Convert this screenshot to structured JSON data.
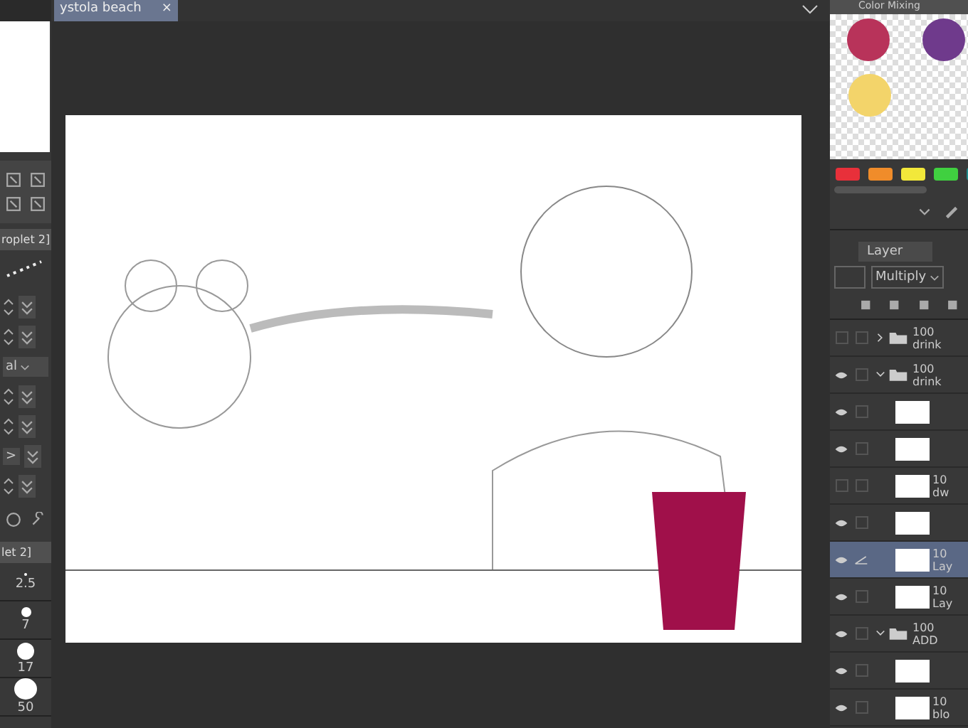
{
  "document_tab": {
    "title": "ystola beach",
    "close": "×"
  },
  "left_panel": {
    "subtool_tab": "roplet 2]",
    "settings_rows": [
      {
        "kind": "spinner"
      },
      {
        "kind": "spinner"
      },
      {
        "kind": "dropdown",
        "value": "al"
      },
      {
        "kind": "spinner"
      },
      {
        "kind": "spinner"
      },
      {
        "kind": "arrow",
        "value": ">"
      },
      {
        "kind": "spinner"
      }
    ],
    "brush_size_tab": "let 2]",
    "brush_sizes": [
      {
        "label": "2.5",
        "selected": false
      },
      {
        "label": "7",
        "selected": false
      },
      {
        "label": "17",
        "selected": false
      },
      {
        "label": "50",
        "selected": false
      }
    ]
  },
  "color_mixing": {
    "tab": "Color Mixing",
    "paint_dots": [
      {
        "color": "#b8335a"
      },
      {
        "color": "#6f3a8c"
      },
      {
        "color": "#f3d46a"
      }
    ],
    "swatches": [
      {
        "color": "#e8303a"
      },
      {
        "color": "#f08c2a"
      },
      {
        "color": "#f2e83a"
      },
      {
        "color": "#40d040"
      },
      {
        "color": "#1e8a8a"
      }
    ]
  },
  "layer_panel": {
    "tab": "Layer",
    "blend_mode": "Multiply",
    "layers": [
      {
        "kind": "folder",
        "visible": false,
        "expanded": false,
        "selected": false,
        "opacity": "100",
        "name": "drink"
      },
      {
        "kind": "folder",
        "visible": true,
        "expanded": true,
        "selected": false,
        "opacity": "100",
        "name": "drink",
        "children": [
          {
            "kind": "layer",
            "visible": true,
            "selected": false
          },
          {
            "kind": "layer",
            "visible": true,
            "selected": false
          },
          {
            "kind": "layer",
            "visible": false,
            "selected": false,
            "opacity": "10",
            "name": "dw"
          },
          {
            "kind": "layer",
            "visible": true,
            "selected": false
          },
          {
            "kind": "layer",
            "visible": true,
            "selected": true,
            "opacity": "10",
            "name": "Lay"
          },
          {
            "kind": "layer",
            "visible": true,
            "selected": false,
            "opacity": "10",
            "name": "Lay"
          }
        ]
      },
      {
        "kind": "folder",
        "visible": true,
        "expanded": true,
        "selected": false,
        "opacity": "100",
        "name": "ADD",
        "children": [
          {
            "kind": "layer",
            "visible": true,
            "selected": false
          },
          {
            "kind": "layer",
            "visible": true,
            "selected": false,
            "opacity": "10",
            "name": "blo"
          }
        ]
      }
    ]
  }
}
